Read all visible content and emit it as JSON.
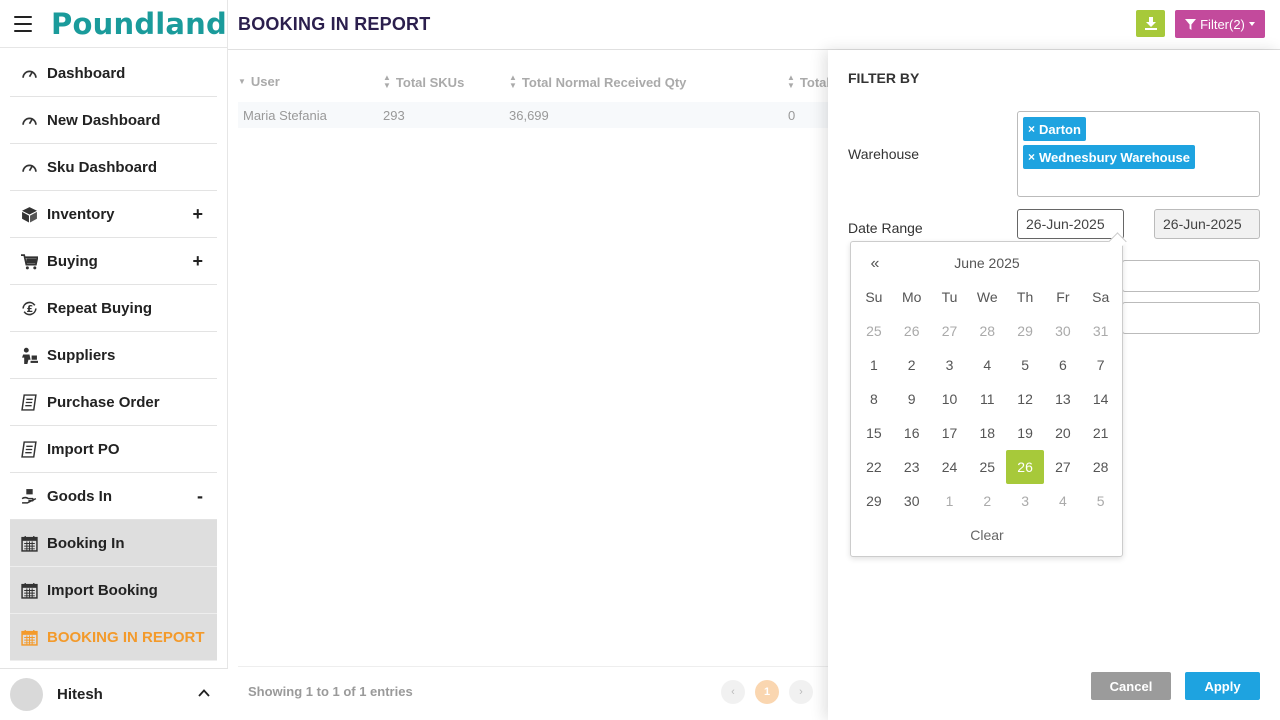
{
  "brand": {
    "name": "Poundland",
    "color": "#1a9b9b"
  },
  "sidebar": {
    "items": [
      {
        "label": "Dashboard",
        "icon": "gauge-icon"
      },
      {
        "label": "New Dashboard",
        "icon": "gauge-icon"
      },
      {
        "label": "Sku Dashboard",
        "icon": "gauge-icon"
      },
      {
        "label": "Inventory",
        "icon": "box-icon",
        "toggle": "+"
      },
      {
        "label": "Buying",
        "icon": "cart-icon",
        "toggle": "+"
      },
      {
        "label": "Repeat Buying",
        "icon": "pound-cycle-icon"
      },
      {
        "label": "Suppliers",
        "icon": "supplier-icon"
      },
      {
        "label": "Purchase Order",
        "icon": "receipt-icon"
      },
      {
        "label": "Import PO",
        "icon": "receipt-icon"
      },
      {
        "label": "Goods In",
        "icon": "hand-box-icon",
        "toggle": "-"
      },
      {
        "label": "Booking In",
        "icon": "calendar-icon"
      },
      {
        "label": "Import Booking",
        "icon": "calendar-icon"
      },
      {
        "label": "BOOKING IN REPORT",
        "icon": "calendar-icon"
      }
    ],
    "active_color": "#f39a2b"
  },
  "user": {
    "name": "Hitesh"
  },
  "header": {
    "title": "BOOKING IN REPORT",
    "filter_label": "Filter(2)",
    "download_color": "#a7c93a",
    "filter_color": "#c34a9c"
  },
  "table": {
    "columns": [
      "User",
      "Total SKUs",
      "Total Normal Received Qty",
      "Total"
    ],
    "rows": [
      [
        "Maria Stefania",
        "293",
        "36,699",
        "0"
      ]
    ]
  },
  "footer": {
    "showing": "Showing 1 to 1 of 1 entries",
    "prev": "‹",
    "current_page": "1",
    "next": "›"
  },
  "filter": {
    "title": "FILTER BY",
    "warehouse_label": "Warehouse",
    "warehouses": [
      "Darton",
      "Wednesbury Warehouse"
    ],
    "date_range_label": "Date Range",
    "date_from": "26-Jun-2025",
    "date_to": "26-Jun-2025",
    "cancel": "Cancel",
    "apply": "Apply",
    "accent": "#1ea3e0"
  },
  "calendar": {
    "prev": "«",
    "month": "June 2025",
    "dow": [
      "Su",
      "Mo",
      "Tu",
      "We",
      "Th",
      "Fr",
      "Sa"
    ],
    "weeks": [
      [
        "25",
        "26",
        "27",
        "28",
        "29",
        "30",
        "31"
      ],
      [
        "1",
        "2",
        "3",
        "4",
        "5",
        "6",
        "7"
      ],
      [
        "8",
        "9",
        "10",
        "11",
        "12",
        "13",
        "14"
      ],
      [
        "15",
        "16",
        "17",
        "18",
        "19",
        "20",
        "21"
      ],
      [
        "22",
        "23",
        "24",
        "25",
        "26",
        "27",
        "28"
      ],
      [
        "29",
        "30",
        "1",
        "2",
        "3",
        "4",
        "5"
      ]
    ],
    "selected": "26",
    "clear": "Clear"
  }
}
